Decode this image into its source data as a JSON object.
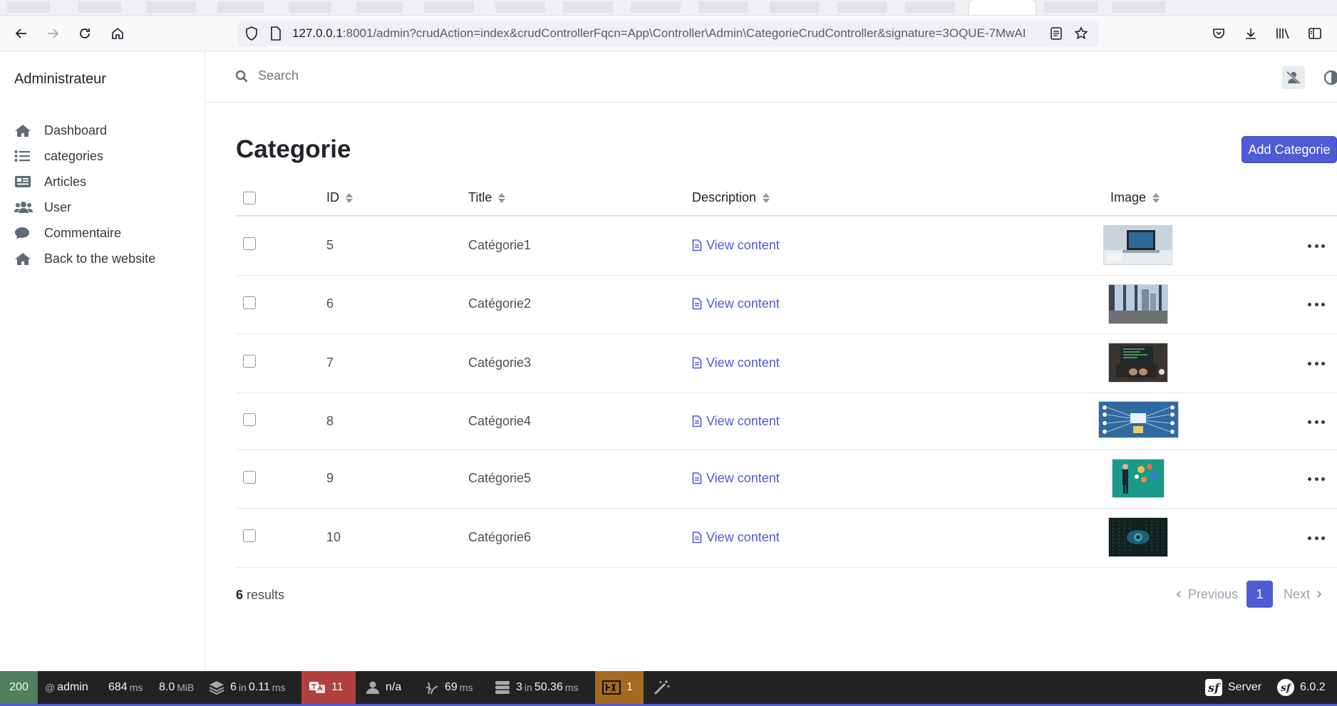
{
  "browser": {
    "url_host": "127.0.0.1",
    "url_rest": ":8001/admin?crudAction=index&crudControllerFqcn=App\\Controller\\Admin\\CategorieCrudController&signature=3OQUE-7MwAI"
  },
  "sidebar": {
    "brand": "Administrateur",
    "items": [
      {
        "label": "Dashboard",
        "icon": "home-icon"
      },
      {
        "label": "categories",
        "icon": "list-icon"
      },
      {
        "label": "Articles",
        "icon": "newspaper-icon"
      },
      {
        "label": "User",
        "icon": "users-icon"
      },
      {
        "label": "Commentaire",
        "icon": "comment-icon"
      },
      {
        "label": "Back to the website",
        "icon": "home-icon"
      }
    ]
  },
  "header": {
    "search_placeholder": "Search"
  },
  "page": {
    "title": "Categorie",
    "add_button": "Add Categorie"
  },
  "table": {
    "columns": [
      "ID",
      "Title",
      "Description",
      "Image"
    ],
    "rows": [
      {
        "id": "5",
        "title": "Catégorie1",
        "description": "View content",
        "image_color": "#5a6b7d"
      },
      {
        "id": "6",
        "title": "Catégorie2",
        "description": "View content",
        "image_color": "#8fa9c4"
      },
      {
        "id": "7",
        "title": "Catégorie3",
        "description": "View content",
        "image_color": "#3a3530"
      },
      {
        "id": "8",
        "title": "Catégorie4",
        "description": "View content",
        "image_color": "#2f6aa0"
      },
      {
        "id": "9",
        "title": "Catégorie5",
        "description": "View content",
        "image_color": "#1a9a8a"
      },
      {
        "id": "10",
        "title": "Catégorie6",
        "description": "View content",
        "image_color": "#1c3a34"
      }
    ]
  },
  "footer": {
    "results_count": "6",
    "results_label": "results",
    "previous": "Previous",
    "page": "1",
    "next": "Next"
  },
  "symfony_toolbar": {
    "status": "200",
    "user": "admin",
    "time": "684",
    "time_unit": "ms",
    "memory": "8.0",
    "memory_unit": "MiB",
    "cache_count": "6",
    "cache_in": "in",
    "cache_time": "0.11",
    "cache_unit": "ms",
    "translation_count": "11",
    "security": "n/a",
    "twig_time": "69",
    "twig_unit": "ms",
    "db_count": "3",
    "db_in": "in",
    "db_time": "50.36",
    "db_unit": "ms",
    "forms_count": "1",
    "server_label": "Server",
    "version": "6.0.2",
    "accent_red": "#b0413e",
    "accent_amber": "#a46a1f",
    "accent_green": "#4f805d"
  }
}
